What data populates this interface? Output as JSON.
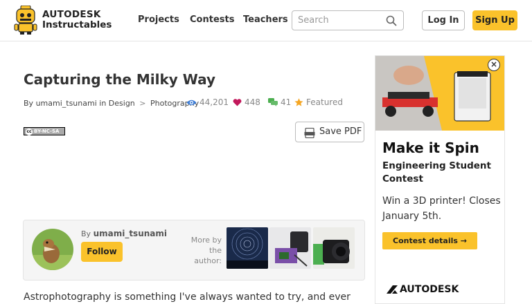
{
  "header": {
    "logo_line1": "AUTODESK",
    "logo_line2": "Instructables",
    "nav": [
      "Projects",
      "Contests",
      "Teachers"
    ],
    "search_placeholder": "Search",
    "login_label": "Log In",
    "signup_label": "Sign Up"
  },
  "article": {
    "title": "Capturing the Milky Way",
    "by_prefix": "By",
    "author": "umami_tsunami",
    "in_word": "in",
    "category": "Design",
    "breadcrumb_sep": ">",
    "subcategory": "Photography",
    "views": "44,201",
    "favorites": "448",
    "comments": "41",
    "featured": "Featured",
    "license": "BY-NC-SA",
    "save_pdf_label": "Save PDF",
    "body_start": "Astrophotography is something I've always wanted to try, and ever"
  },
  "author_box": {
    "by_label": "By",
    "author": "umami_tsunami",
    "follow_label": "Follow",
    "more_by_label": "More by the author:"
  },
  "ad": {
    "title": "Make it Spin",
    "subtitle": "Engineering Student Contest",
    "description": "Win a 3D printer! Closes January 5th.",
    "button_label": "Contest details",
    "button_arrow": "→",
    "close_label": "×",
    "brand": "AUTODESK"
  },
  "colors": {
    "accent": "#fac22b",
    "view_icon": "#3a7bd5",
    "heart_icon": "#c2185b",
    "comment_icon": "#4caf50",
    "star_icon": "#f5a623"
  }
}
